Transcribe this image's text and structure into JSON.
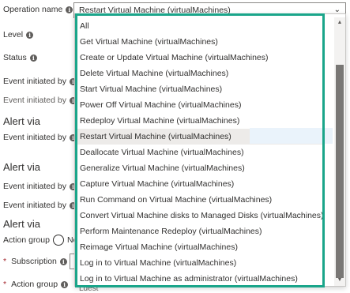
{
  "form": {
    "operation_name_label": "Operation name",
    "level_label": "Level",
    "status_label": "Status",
    "event_initiated_by_label": "Event initiated by",
    "alert_via_heading": "Alert via",
    "action_group_label": "Action group",
    "action_group_radio_label": "Ne",
    "subscription_label": "Subscription",
    "bottom_value": "Ldest"
  },
  "combo": {
    "selected_value": "Restart Virtual Machine (virtualMachines)"
  },
  "dropdown": {
    "options": [
      "All",
      "Get Virtual Machine (virtualMachines)",
      "Create or Update Virtual Machine (virtualMachines)",
      "Delete Virtual Machine (virtualMachines)",
      "Start Virtual Machine (virtualMachines)",
      "Power Off Virtual Machine (virtualMachines)",
      "Redeploy Virtual Machine (virtualMachines)",
      "Restart Virtual Machine (virtualMachines)",
      "Deallocate Virtual Machine (virtualMachines)",
      "Generalize Virtual Machine (virtualMachines)",
      "Capture Virtual Machine (virtualMachines)",
      "Run Command on Virtual Machine (virtualMachines)",
      "Convert Virtual Machine disks to Managed Disks (virtualMachines)",
      "Perform Maintenance Redeploy (virtualMachines)",
      "Reimage Virtual Machine (virtualMachines)",
      "Log in to Virtual Machine (virtualMachines)",
      "Log in to Virtual Machine as administrator (virtualMachines)"
    ],
    "selected_index": 7
  },
  "colors": {
    "highlight_frame": "#1aa58a",
    "required_star": "#a4262c"
  },
  "icons": {
    "info": "info-icon",
    "chevron": "chevron-down-icon"
  }
}
